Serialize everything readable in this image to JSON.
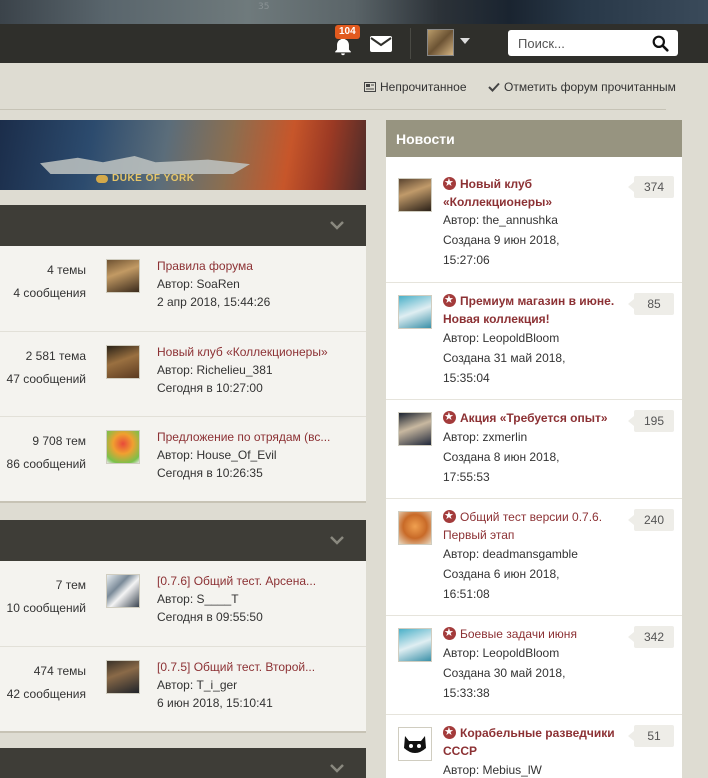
{
  "header": {
    "art_number": "35",
    "notifications_count": "104",
    "search_placeholder": "Поиск..."
  },
  "sublinks": {
    "unread": "Непрочитанное",
    "mark_read": "Отметить форум прочитанным"
  },
  "banner": {
    "title": "DUKE OF YORK"
  },
  "sections": [
    {
      "rows": [
        {
          "stat1": "4 темы",
          "stat2": "4 сообщения",
          "title": "Правила форума",
          "author": "Автор: SoaRen",
          "date": "2 апр 2018, 15:44:26"
        },
        {
          "stat1": "2 581 тема",
          "stat2": "47 сообщений",
          "title": "Новый клуб «Коллекционеры»",
          "author": "Автор: Richelieu_381",
          "date": "Сегодня в 10:27:00"
        },
        {
          "stat1": "9 708 тем",
          "stat2": "86 сообщений",
          "title": "Предложение по отрядам (вс...",
          "author": "Автор: House_Of_Evil",
          "date": "Сегодня в 10:26:35"
        }
      ]
    },
    {
      "rows": [
        {
          "stat1": "7 тем",
          "stat2": "10 сообщений",
          "title": "[0.7.6] Общий тест. Арсена...",
          "author": "Автор: S____T",
          "date": "Сегодня в 09:55:50"
        },
        {
          "stat1": "474 темы",
          "stat2": "42 сообщения",
          "title": "[0.7.5] Общий тест. Второй...",
          "author": "Автор: T_i_ger",
          "date": "6 июн 2018, 15:10:41"
        }
      ]
    }
  ],
  "news": {
    "title": "Новости",
    "items": [
      {
        "title": "Новый клуб «Коллекционеры»",
        "author": "Автор: the_annushka",
        "created": "Создана 9 июн 2018,",
        "time": "15:27:06",
        "count": "374"
      },
      {
        "title": "Премиум магазин в июне. Новая коллекция!",
        "author": "Автор: LeopoldBloom",
        "created": "Создана 31 май 2018,",
        "time": "15:35:04",
        "count": "85"
      },
      {
        "title": "Акция «Требуется опыт»",
        "author": "Автор: zxmerlin",
        "created": "Создана 8 июн 2018,",
        "time": "17:55:53",
        "count": "195"
      },
      {
        "title": "Общий тест версии 0.7.6. Первый этап",
        "author": "Автор: deadmansgamble",
        "created": "Создана 6 июн 2018,",
        "time": "16:51:08",
        "count": "240"
      },
      {
        "title": "Боевые задачи июня",
        "author": "Автор: LeopoldBloom",
        "created": "Создана 30 май 2018,",
        "time": "15:33:38",
        "count": "342"
      },
      {
        "title": "Корабельные разведчики СССР",
        "author": "Автор: Mebius_lW",
        "created": "",
        "time": "",
        "count": "51"
      }
    ]
  },
  "colors": {
    "link": "#8c3134",
    "news_header": "#979480",
    "section_header": "#3e3d37",
    "badge": "#e25a1e"
  }
}
